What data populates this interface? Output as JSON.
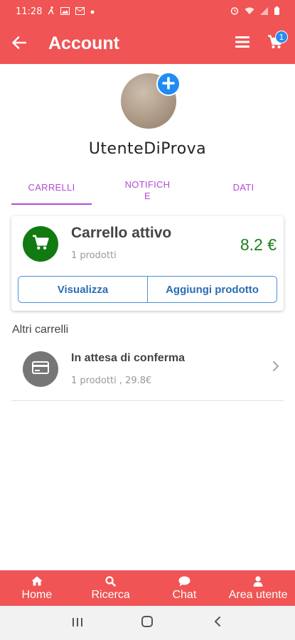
{
  "status_bar": {
    "time": "11:28",
    "icons_left": [
      "walk-icon",
      "image-icon",
      "mail-icon",
      "dot-icon"
    ],
    "icons_right": [
      "alarm-icon",
      "wifi-icon",
      "signal-icon",
      "battery-icon"
    ]
  },
  "app_bar": {
    "title": "Account",
    "cart_badge": "1",
    "color": "#f05454"
  },
  "profile": {
    "username": "UtenteDiProva"
  },
  "tabs": [
    {
      "label": "CARRELLI",
      "active": true
    },
    {
      "label": "NOTIFICH\nE",
      "active": false
    },
    {
      "label": "DATI",
      "active": false
    }
  ],
  "active_cart": {
    "title": "Carrello attivo",
    "subtitle": "1 prodotti",
    "price": "8.2 €",
    "view_label": "Visualizza",
    "add_label": "Aggiungi prodotto"
  },
  "other_carts": {
    "title": "Altri carrelli",
    "items": [
      {
        "title": "In attesa di conferma",
        "subtitle": "1 prodotti , 29.8€"
      }
    ]
  },
  "bottom_nav": [
    {
      "label": "Home",
      "icon": "home-icon"
    },
    {
      "label": "Ricerca",
      "icon": "search-icon"
    },
    {
      "label": "Chat",
      "icon": "chat-icon"
    },
    {
      "label": "Area utente",
      "icon": "user-icon"
    }
  ],
  "accent": {
    "primary": "#f05454",
    "tab": "#b24bd6",
    "price": "#1d7f1d",
    "button": "#2a6db5"
  }
}
